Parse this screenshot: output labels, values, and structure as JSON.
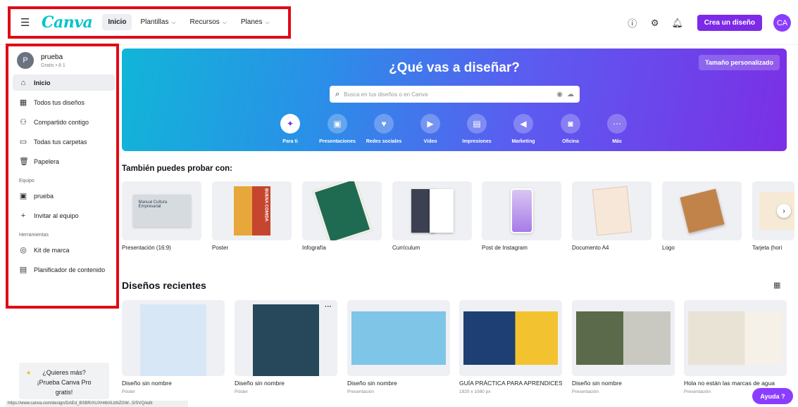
{
  "header": {
    "logo": "Canva",
    "nav": [
      {
        "label": "Inicio"
      },
      {
        "label": "Plantillas"
      },
      {
        "label": "Recursos"
      },
      {
        "label": "Planes"
      }
    ],
    "create_label": "Crea un diseño",
    "avatar": "CA"
  },
  "sidebar": {
    "user_initial": "P",
    "user_name": "prueba",
    "user_sub": "Gratis • 8 1",
    "items": [
      {
        "label": "Inicio",
        "icon": "home-icon"
      },
      {
        "label": "Todos tus diseños",
        "icon": "grid-icon"
      },
      {
        "label": "Compartido contigo",
        "icon": "people-icon"
      },
      {
        "label": "Todas tus carpetas",
        "icon": "folder-icon"
      },
      {
        "label": "Papelera",
        "icon": "trash-icon"
      }
    ],
    "team_heading": "Equipo",
    "team_items": [
      {
        "label": "prueba"
      },
      {
        "label": "Invitar al equipo"
      }
    ],
    "tools_heading": "Herramientas",
    "tools_items": [
      {
        "label": "Kit de marca"
      },
      {
        "label": "Planificador de contenido"
      }
    ],
    "promo_l1": "¿Quieres más?",
    "promo_l2": "¡Prueba Canva Pro",
    "promo_l3": "gratis!"
  },
  "hero": {
    "title": "¿Qué vas a diseñar?",
    "custom_size": "Tamaño personalizado",
    "search_placeholder": "Busca en tus diseños o en Canva",
    "categories": [
      {
        "label": "Para ti"
      },
      {
        "label": "Presentaciones"
      },
      {
        "label": "Redes sociales"
      },
      {
        "label": "Vídeo"
      },
      {
        "label": "Impresiones"
      },
      {
        "label": "Marketing"
      },
      {
        "label": "Oficina"
      },
      {
        "label": "Más"
      }
    ]
  },
  "try_title": "También puedes probar con:",
  "templates": [
    {
      "label": "Presentación (16:9)"
    },
    {
      "label": "Poster"
    },
    {
      "label": "Infografía"
    },
    {
      "label": "Currículum"
    },
    {
      "label": "Post de Instagram"
    },
    {
      "label": "Documento A4"
    },
    {
      "label": "Logo"
    },
    {
      "label": "Tarjeta (hori"
    }
  ],
  "recent_title": "Diseños recientes",
  "recent": [
    {
      "title": "Diseño sin nombre",
      "sub": "Póster"
    },
    {
      "title": "Diseño sin nombre",
      "sub": "Póster"
    },
    {
      "title": "Diseño sin nombre",
      "sub": "Presentación"
    },
    {
      "title": "GUÍA PRÁCTICA PARA APRENDICES...",
      "sub": "1920 x 1080 px"
    },
    {
      "title": "Diseño sin nombre",
      "sub": "Presentación"
    },
    {
      "title": "Hola no están las marcas de agua",
      "sub": "Presentación"
    }
  ],
  "help": "Ayuda ?",
  "status_url": "https://www.canva.com/design/DAEd_BSBR/XUXH4bXLbNZGW...5/SVQ/edit",
  "colors": {
    "accent": "#7d2ae8",
    "annotation": "#e00a16"
  }
}
